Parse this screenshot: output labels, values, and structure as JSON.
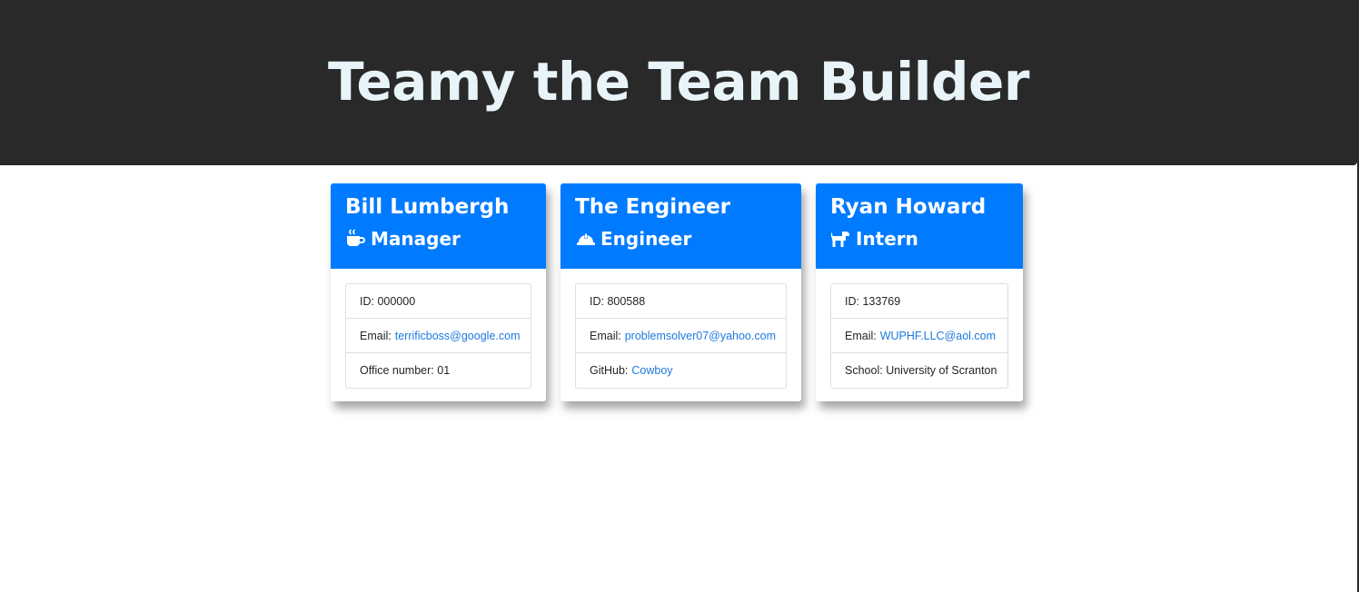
{
  "app": {
    "title": "Teamy the Team Builder"
  },
  "colors": {
    "header_bg": "#292929",
    "title_text": "#e8f4f8",
    "card_head_bg": "#007bff",
    "link": "#1f7ae0"
  },
  "cards": [
    {
      "name": "Bill Lumbergh",
      "role": "Manager",
      "role_icon": "coffee-mug-icon",
      "id_text": "ID: 000000",
      "email_label": "Email:",
      "email": "terrificboss@google.com",
      "extra_label": "Office number:",
      "extra_value": "01"
    },
    {
      "name": "The Engineer",
      "role": "Engineer",
      "role_icon": "hard-hat-icon",
      "id_text": "ID: 800588",
      "email_label": "Email:",
      "email": "problemsolver07@yahoo.com",
      "extra_label": "GitHub:",
      "extra_value": "Cowboy"
    },
    {
      "name": "Ryan Howard",
      "role": "Intern",
      "role_icon": "dog-icon",
      "id_text": "ID: 133769",
      "email_label": "Email:",
      "email": "WUPHF.LLC@aol.com",
      "extra_label": "School:",
      "extra_value": "University of Scranton"
    }
  ]
}
